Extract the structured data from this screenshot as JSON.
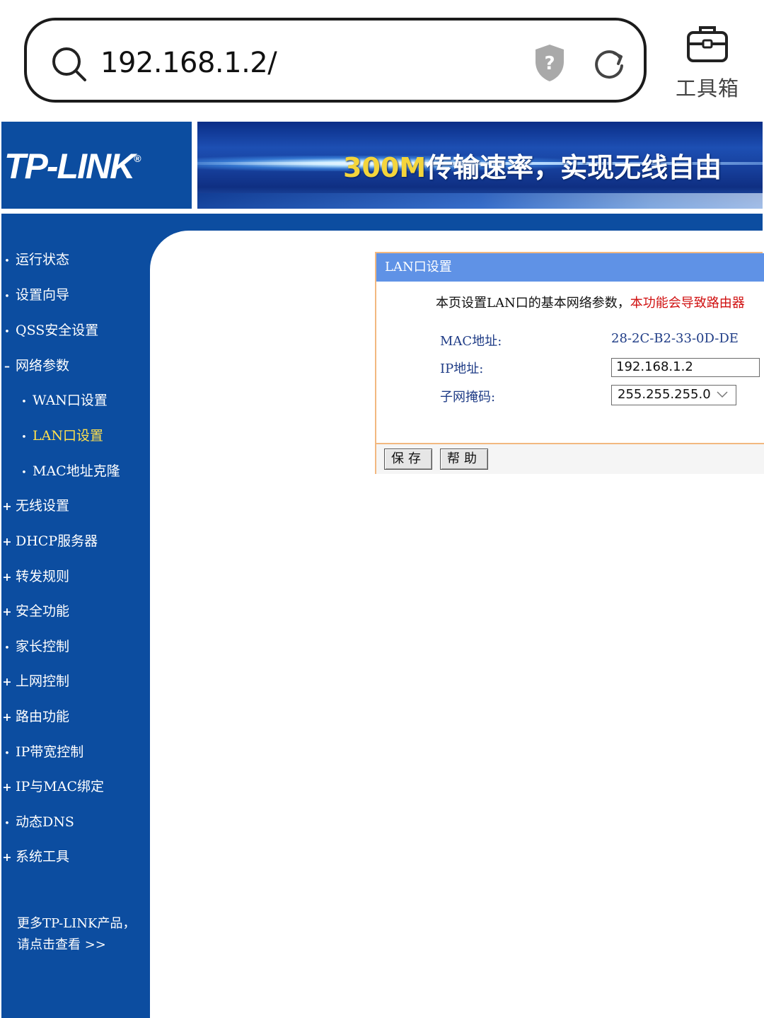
{
  "browser": {
    "url": "192.168.1.2/",
    "toolbox_label": "工具箱"
  },
  "banner": {
    "logo_text": "TP-LINK",
    "logo_mark": "®",
    "slogan_highlight": "300M",
    "slogan_rest": "传输速率，实现无线自由"
  },
  "sidebar": {
    "items": [
      {
        "label": "运行状态",
        "marker": "•"
      },
      {
        "label": "设置向导",
        "marker": "•"
      },
      {
        "label": "QSS安全设置",
        "marker": "•"
      },
      {
        "label": "网络参数",
        "marker": "–"
      },
      {
        "label": "WAN口设置",
        "marker": "•"
      },
      {
        "label": "LAN口设置",
        "marker": "•"
      },
      {
        "label": "MAC地址克隆",
        "marker": "•"
      },
      {
        "label": "无线设置",
        "marker": "+"
      },
      {
        "label": "DHCP服务器",
        "marker": "+"
      },
      {
        "label": "转发规则",
        "marker": "+"
      },
      {
        "label": "安全功能",
        "marker": "+"
      },
      {
        "label": "家长控制",
        "marker": "•"
      },
      {
        "label": "上网控制",
        "marker": "+"
      },
      {
        "label": "路由功能",
        "marker": "+"
      },
      {
        "label": "IP带宽控制",
        "marker": "•"
      },
      {
        "label": "IP与MAC绑定",
        "marker": "+"
      },
      {
        "label": "动态DNS",
        "marker": "•"
      },
      {
        "label": "系统工具",
        "marker": "+"
      }
    ],
    "more_line1": "更多TP-LINK产品，",
    "more_line2": "请点击查看 >>"
  },
  "panel": {
    "title": "LAN口设置",
    "desc_normal": "本页设置LAN口的基本网络参数，",
    "desc_warning": "本功能会导致路由器",
    "mac_label": "MAC地址:",
    "mac_value": "28-2C-B2-33-0D-DE",
    "ip_label": "IP地址:",
    "ip_value": "192.168.1.2",
    "mask_label": "子网掩码:",
    "mask_value": "255.255.255.0",
    "save_label": "保存",
    "help_label": "帮助"
  },
  "colors": {
    "router_blue": "#0c4da0",
    "panel_header": "#5f92e6",
    "panel_border": "#f2b880",
    "active_menu": "#ffe04d",
    "warning_red": "#d01010"
  }
}
